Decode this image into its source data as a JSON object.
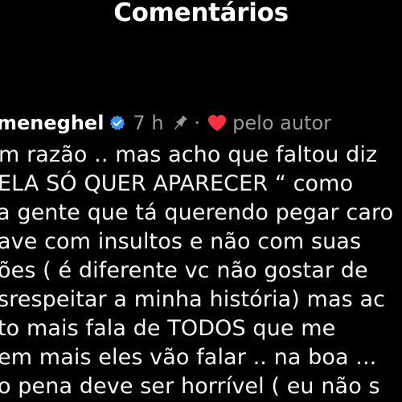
{
  "header": {
    "title": "Comentários"
  },
  "comment": {
    "username": "meneghel",
    "time": "7 h",
    "separator": "·",
    "by_author_label": "pelo autor",
    "icons": {
      "verified": "verified-badge-icon",
      "pin": "pin-icon",
      "heart": "heart-icon"
    },
    "colors": {
      "verified": "#3897f0",
      "heart": "#ff3040",
      "muted_text": "#9a9a9a"
    },
    "lines": [
      "m razão .. mas acho que faltou diz",
      "ELA SÓ QUER APARECER “ como",
      "a gente que tá querendo pegar caro",
      "ave com insultos e não com suas",
      "ões ( é diferente vc não gostar de",
      "srespeitar a minha história) mas ac",
      "to mais fala de TODOS que me",
      "em mais eles vão falar .. na boa ...",
      "o pena deve ser horrível ( eu não s"
    ]
  }
}
